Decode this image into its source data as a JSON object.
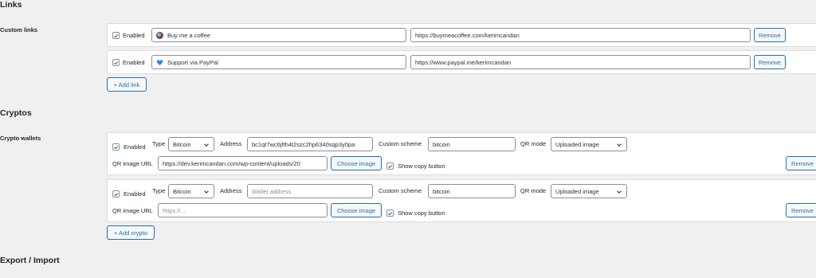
{
  "sections": {
    "links_title": "Links",
    "cryptos_title": "Cryptos",
    "export_title": "Export / Import"
  },
  "custom_links": {
    "label": "Custom links",
    "items": [
      {
        "enabled_label": "Enabled",
        "title": "Buy me a coffee",
        "icon": "coffee-emoji-icon",
        "url": "https://buymeacoffee.com/kerimcandan",
        "remove_label": "Remove"
      },
      {
        "enabled_label": "Enabled",
        "title": "Support via PayPal",
        "icon": "blue-heart-icon",
        "url": "https://www.paypal.me/kerimcandan",
        "remove_label": "Remove"
      }
    ],
    "add_label": "+ Add link"
  },
  "crypto_wallets": {
    "label": "Crypto wallets",
    "items": [
      {
        "enabled_label": "Enabled",
        "type_label": "Type",
        "type_value": "Bitcoin",
        "address_label": "Address",
        "address_value": "bc1qt7wc6jfth4t2szc2hp6340sqp3y0pa",
        "custom_scheme_label": "Custom scheme",
        "custom_scheme_value": "bitcoin",
        "qr_mode_label": "QR mode",
        "qr_mode_value": "Uploaded image",
        "qr_url_label": "QR image URL",
        "qr_url_value": "https://dev.kerimcandan.com/wp-content/uploads/20",
        "choose_image_label": "Choose image",
        "show_copy_label": "Show copy button",
        "remove_label": "Remove"
      },
      {
        "enabled_label": "Enabled",
        "type_label": "Type",
        "type_value": "Bitcoin",
        "address_label": "Address",
        "address_placeholder": "Wallet address",
        "custom_scheme_label": "Custom scheme",
        "custom_scheme_value": "bitcoin",
        "qr_mode_label": "QR mode",
        "qr_mode_value": "Uploaded image",
        "qr_url_label": "QR image URL",
        "qr_url_placeholder": "https://...",
        "choose_image_label": "Choose image",
        "show_copy_label": "Show copy button",
        "remove_label": "Remove"
      }
    ],
    "add_label": "+ Add crypto"
  },
  "colors": {
    "accent": "#2271b1",
    "background": "#f0f0f1",
    "card": "#ffffff",
    "border": "#dcdcde"
  }
}
